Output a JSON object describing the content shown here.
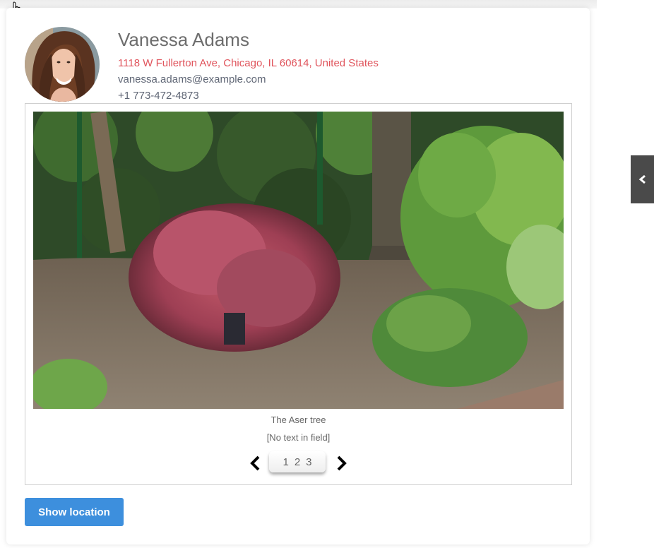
{
  "profile": {
    "name": "Vanessa Adams",
    "address": "1118 W Fullerton Ave, Chicago, IL 60614, United States",
    "email": "vanessa.adams@example.com",
    "phone": "+1 773-472-4873",
    "avatar_icon": "avatar-photo"
  },
  "gallery": {
    "caption": "The Aser tree",
    "description": "[No text in field]",
    "pages": [
      "1",
      "2",
      "3"
    ],
    "prev_icon": "chevron-left-icon",
    "next_icon": "chevron-right-icon"
  },
  "actions": {
    "show_location_label": "Show location"
  },
  "side_panel": {
    "toggle_icon": "chevron-left-icon"
  },
  "colors": {
    "address": "#e0545c",
    "button": "#3d8fdd",
    "side_tab": "#4a4a4a"
  }
}
